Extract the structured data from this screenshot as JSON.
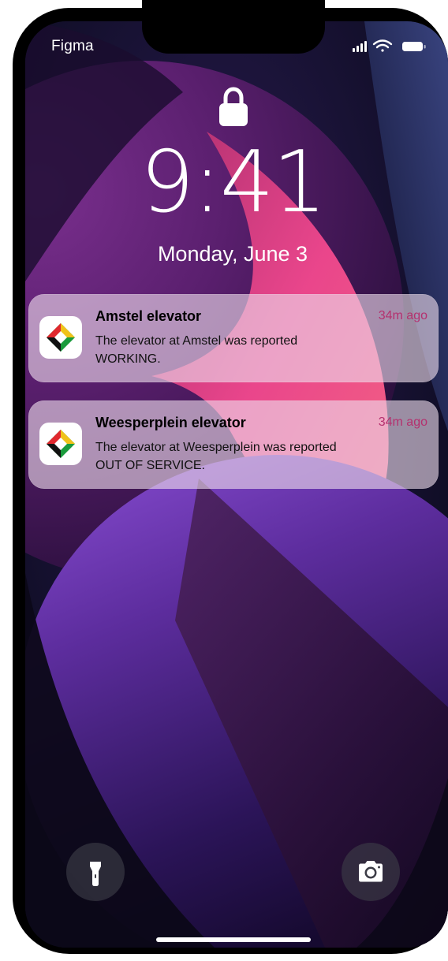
{
  "status_bar": {
    "carrier": "Figma",
    "icons": [
      "signal-icon",
      "wifi-icon",
      "battery-icon"
    ]
  },
  "lock_screen": {
    "time": "9:41",
    "date": "Monday, June 3"
  },
  "notifications": [
    {
      "app_icon": "elevator-app-icon",
      "title": "Amstel elevator",
      "time": "34m ago",
      "body_line1": "The elevator at Amstel was reported",
      "body_line2": "WORKING."
    },
    {
      "app_icon": "elevator-app-icon",
      "title": "Weesperplein elevator",
      "time": "34m ago",
      "body_line1": "The elevator at Weesperplein was reported",
      "body_line2": "OUT OF SERVICE."
    }
  ],
  "quick_actions": {
    "left": "flashlight-icon",
    "right": "camera-icon"
  },
  "colors": {
    "notification_time": "#b5306e",
    "notification_bg": "#eedcec",
    "wallpaper_pink": "#ff4f93",
    "wallpaper_purple": "#6b2cab",
    "wallpaper_dark": "#0b0a1e"
  }
}
